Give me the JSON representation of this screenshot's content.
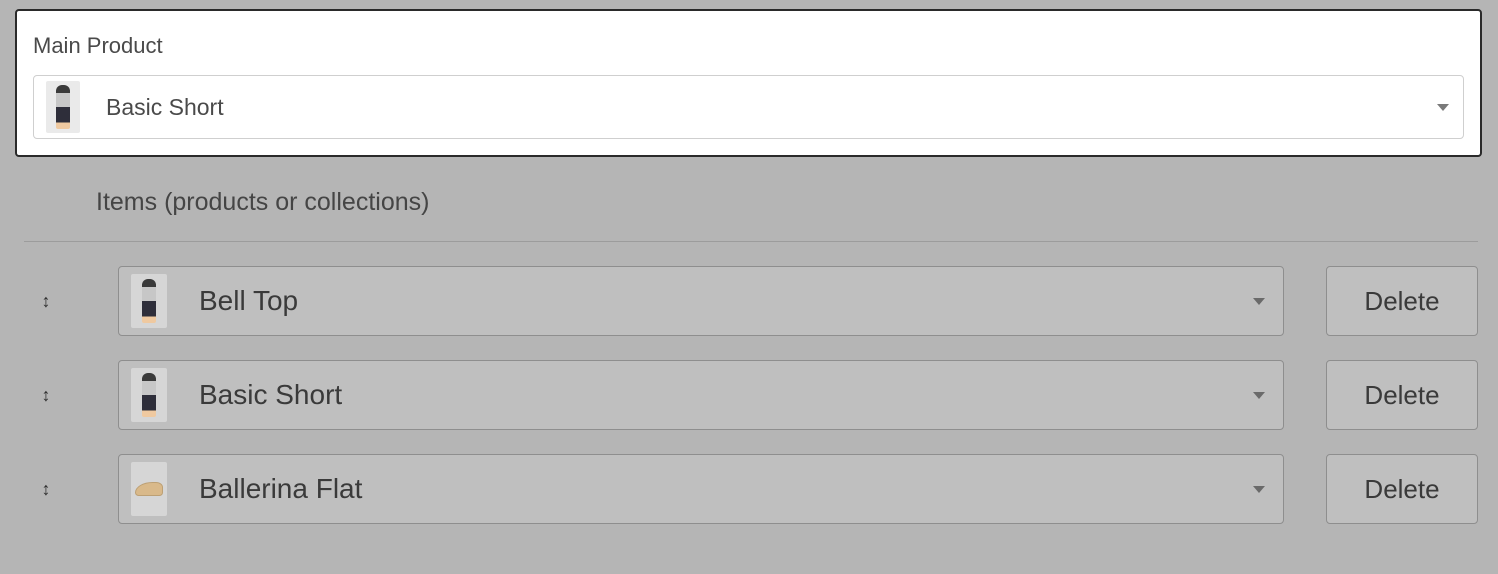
{
  "main_product": {
    "label": "Main Product",
    "selected": "Basic Short"
  },
  "items_section": {
    "heading": "Items (products or collections)",
    "delete_label": "Delete",
    "items": [
      {
        "name": "Bell Top",
        "thumb": "person"
      },
      {
        "name": "Basic Short",
        "thumb": "person"
      },
      {
        "name": "Ballerina Flat",
        "thumb": "shoe"
      }
    ]
  }
}
